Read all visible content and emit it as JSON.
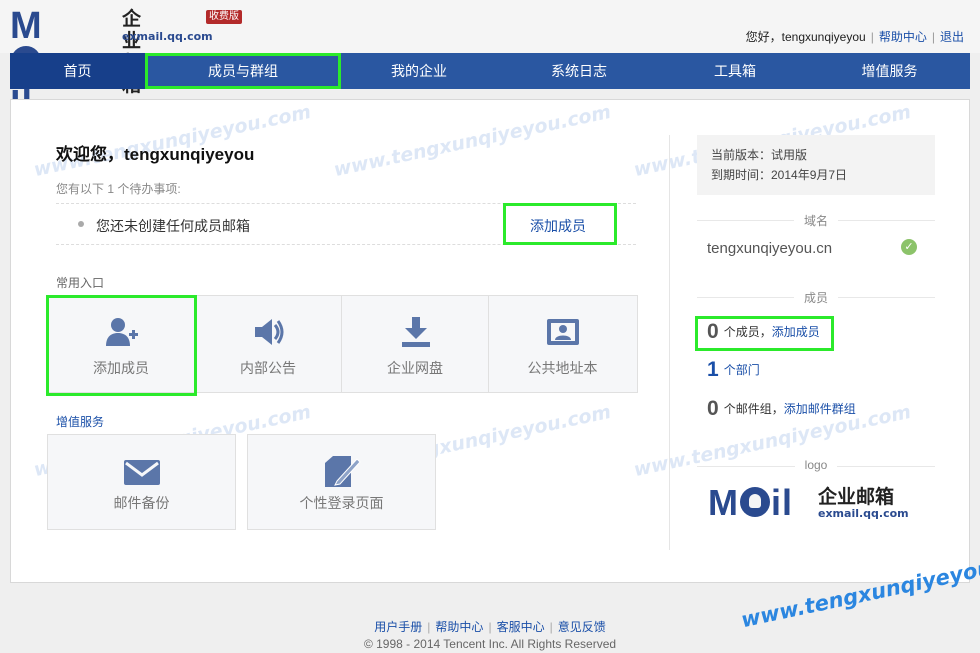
{
  "header": {
    "logo_mark": "M",
    "logo_mark_tail": "il",
    "logo_cn": "企业邮箱",
    "logo_en": "exmail.qq.com",
    "badge": "收费版",
    "greeting": "您好，tengxunqiyeyou",
    "help_link": "帮助中心",
    "logout_link": "退出"
  },
  "nav": {
    "tabs": [
      {
        "label": "首页"
      },
      {
        "label": "成员与群组"
      },
      {
        "label": "我的企业"
      },
      {
        "label": "系统日志"
      },
      {
        "label": "工具箱"
      },
      {
        "label": "增值服务"
      }
    ]
  },
  "main": {
    "welcome": "欢迎您，tengxunqiyeyou",
    "todo_hint": "您有以下 1 个待办事项:",
    "todo_text": "您还未创建任何成员邮箱",
    "todo_action": "添加成员",
    "common_title": "常用入口",
    "common_tiles": [
      {
        "label": "添加成员",
        "icon": "add-user-icon"
      },
      {
        "label": "内部公告",
        "icon": "speaker-icon"
      },
      {
        "label": "企业网盘",
        "icon": "download-icon"
      },
      {
        "label": "公共地址本",
        "icon": "contact-card-icon"
      }
    ],
    "vas_title": "增值服务",
    "vas_tiles": [
      {
        "label": "邮件备份",
        "icon": "envelope-icon"
      },
      {
        "label": "个性登录页面",
        "icon": "edit-page-icon"
      }
    ]
  },
  "side": {
    "version_label": "当前版本：试用版",
    "expire_label": "到期时间：2014年9月7日",
    "domain_title": "域名",
    "domain": "tengxunqiyeyou.cn",
    "members_title": "成员",
    "members_count": "0",
    "members_unit": "个成员，",
    "members_action": "添加成员",
    "dept_count": "1",
    "dept_unit": "个部门",
    "group_count": "0",
    "group_unit": "个邮件组，",
    "group_action": "添加邮件群组",
    "logo_title": "logo"
  },
  "footer": {
    "links": [
      "用户手册",
      "帮助中心",
      "客服中心",
      "意见反馈"
    ],
    "copyright": "© 1998 - 2014 Tencent Inc. All Rights Reserved"
  },
  "watermark": "www.tengxunqiyeyou.com",
  "colors": {
    "brand": "#2a4a8f",
    "nav": "#2a57a1",
    "nav_active": "#173f8a",
    "link": "#1a4fa8",
    "highlight": "#2bea2b",
    "watermark": "#2b86e0"
  }
}
